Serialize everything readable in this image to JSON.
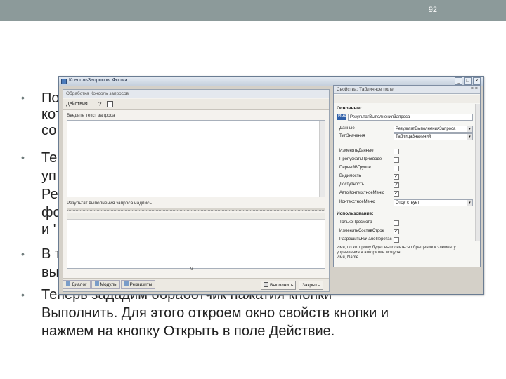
{
  "slide": {
    "number": "92",
    "header_color": "#8c9a9a"
  },
  "bullets": [
    {
      "lines": [
        "По",
        "кот",
        "со"
      ]
    },
    {
      "lines": [
        "Те",
        "уп",
        "Ре",
        "фо",
        "и '"
      ]
    },
    {
      "lines": [
        "В т",
        "вы"
      ]
    },
    {
      "lines": [
        "Теперь зададим обработчик нажатия кнопки",
        "Выполнить. Для этого откроем окно свойств кнопки и",
        "нажмем на кнопку Открыть в поле Действие."
      ]
    }
  ],
  "window": {
    "title": "КонсольЗапросов: Форма",
    "left_pane": {
      "title": "Обработка Консоль запросов",
      "toolbar_actions": "Действия",
      "toolbar_help": "?",
      "query_label": "Введите текст запроса",
      "result_label": "Результат выполнения запроса надпись",
      "run_button": "Выполнить",
      "close_button": "Закрыть",
      "arrow": "v"
    },
    "tabs": [
      "Диалог",
      "Модуль",
      "Реквизиты"
    ],
    "properties": {
      "title": "Свойства: Табличное поле",
      "group_basic": "Основные:",
      "name_label": "Имя",
      "name_value": "РезультатВыполненияЗапроса",
      "data_label": "Данные",
      "data_value": "РезультатВыполненияЗапроса",
      "type_label": "ТипЗначения",
      "type_value": "ТаблицаЗначений",
      "flags": [
        {
          "label": "ИзменятьДанные",
          "checked": false
        },
        {
          "label": "ПропускатьПриВводе",
          "checked": false
        },
        {
          "label": "ПервыйВГруппе",
          "checked": false
        },
        {
          "label": "Видимость",
          "checked": true
        },
        {
          "label": "Доступность",
          "checked": true
        },
        {
          "label": "АвтоКонтекстноеМеню",
          "checked": true
        }
      ],
      "context_menu_label": "КонтекстноеМеню",
      "context_menu_value": "Отсутствует",
      "group_usage": "Использование:",
      "usage_flags": [
        {
          "label": "ТолькоПросмотр",
          "checked": false
        },
        {
          "label": "ИзменятьСоставСтрок",
          "checked": true
        },
        {
          "label": "РазрешитьНачалоПеретас",
          "checked": false
        }
      ],
      "description": "Имя, по которому будет выполняться обращение к элементу управления в алгоритме модуля",
      "description_en": "Имя, Name"
    }
  }
}
